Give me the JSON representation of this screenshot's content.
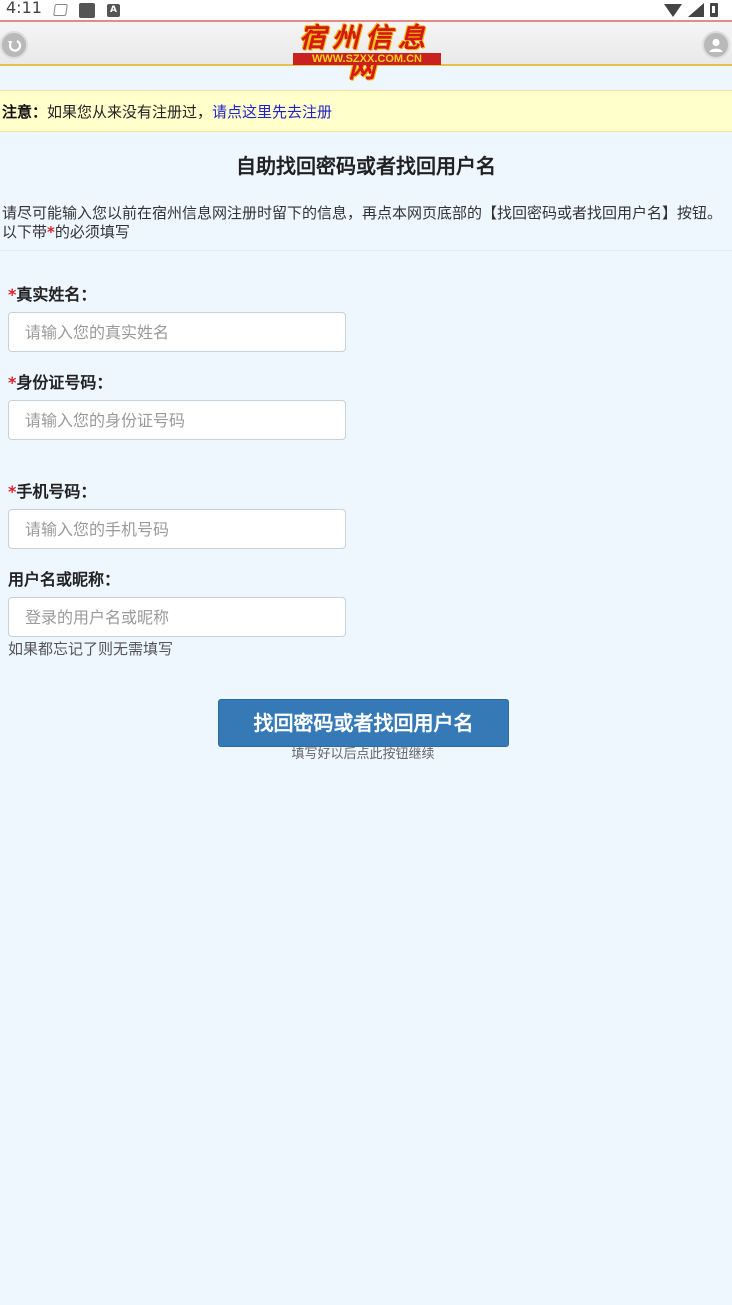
{
  "status_bar": {
    "time": "4:11"
  },
  "header": {
    "logo_title": "宿州信息网",
    "logo_url": "WWW.SZXX.COM.CN"
  },
  "notice": {
    "label": "注意",
    "colon": "：",
    "text": "如果您从来没有注册过，",
    "link": "请点这里先去注册"
  },
  "page": {
    "title": "自助找回密码或者找回用户名",
    "intro_before": "请尽可能输入您以前在宿州信息网注册时留下的信息，再点本网页底部的【找回密码或者找回用户名】按钮。以下带",
    "intro_star": "*",
    "intro_after": "的必须填写"
  },
  "form": {
    "required_mark": "*",
    "real_name": {
      "label": "真实姓名：",
      "placeholder": "请输入您的真实姓名"
    },
    "id_number": {
      "label": "身份证号码：",
      "placeholder": "请输入您的身份证号码"
    },
    "phone": {
      "label": "手机号码：",
      "placeholder": "请输入您的手机号码"
    },
    "username": {
      "label": "用户名或昵称：",
      "placeholder": "登录的用户名或昵称",
      "hint": "如果都忘记了则无需填写"
    },
    "submit_label": "找回密码或者找回用户名",
    "submit_hint": "填写好以后点此按钮继续"
  }
}
